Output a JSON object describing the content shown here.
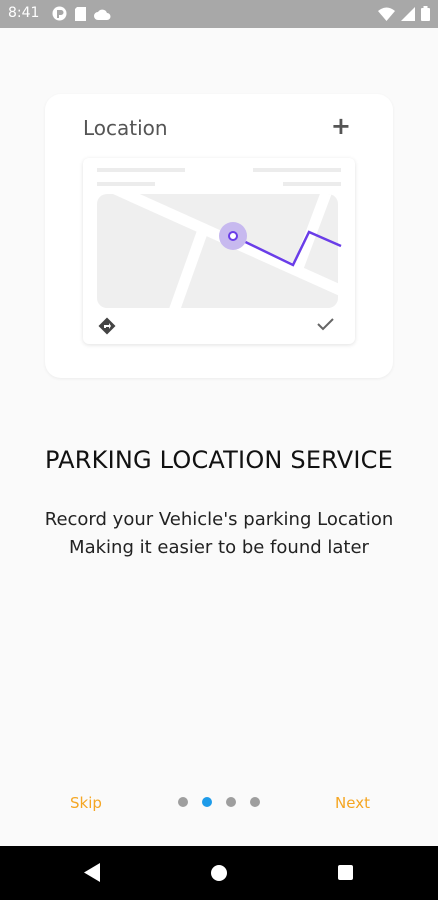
{
  "status_bar": {
    "time": "8:41",
    "left_icons": [
      "pocket-icon",
      "sim-icon",
      "cloud-icon"
    ],
    "right_icons": [
      "wifi-icon",
      "signal-icon",
      "battery-icon"
    ]
  },
  "illustration": {
    "card_title": "Location",
    "plus_symbol": "+",
    "route_color": "#6a3de8"
  },
  "onboarding": {
    "heading": "PARKING LOCATION SERVICE",
    "description_line1": "Record your Vehicle's parking Location",
    "description_line2": "Making it easier to be found later"
  },
  "footer": {
    "skip_label": "Skip",
    "next_label": "Next",
    "page_count": 4,
    "active_page": 2
  },
  "colors": {
    "accent": "#f5a623",
    "active_dot": "#1e9be9",
    "inactive_dot": "#9e9e9e"
  },
  "navigation_bar": {
    "icons": [
      "back-icon",
      "home-icon",
      "recents-icon"
    ]
  }
}
